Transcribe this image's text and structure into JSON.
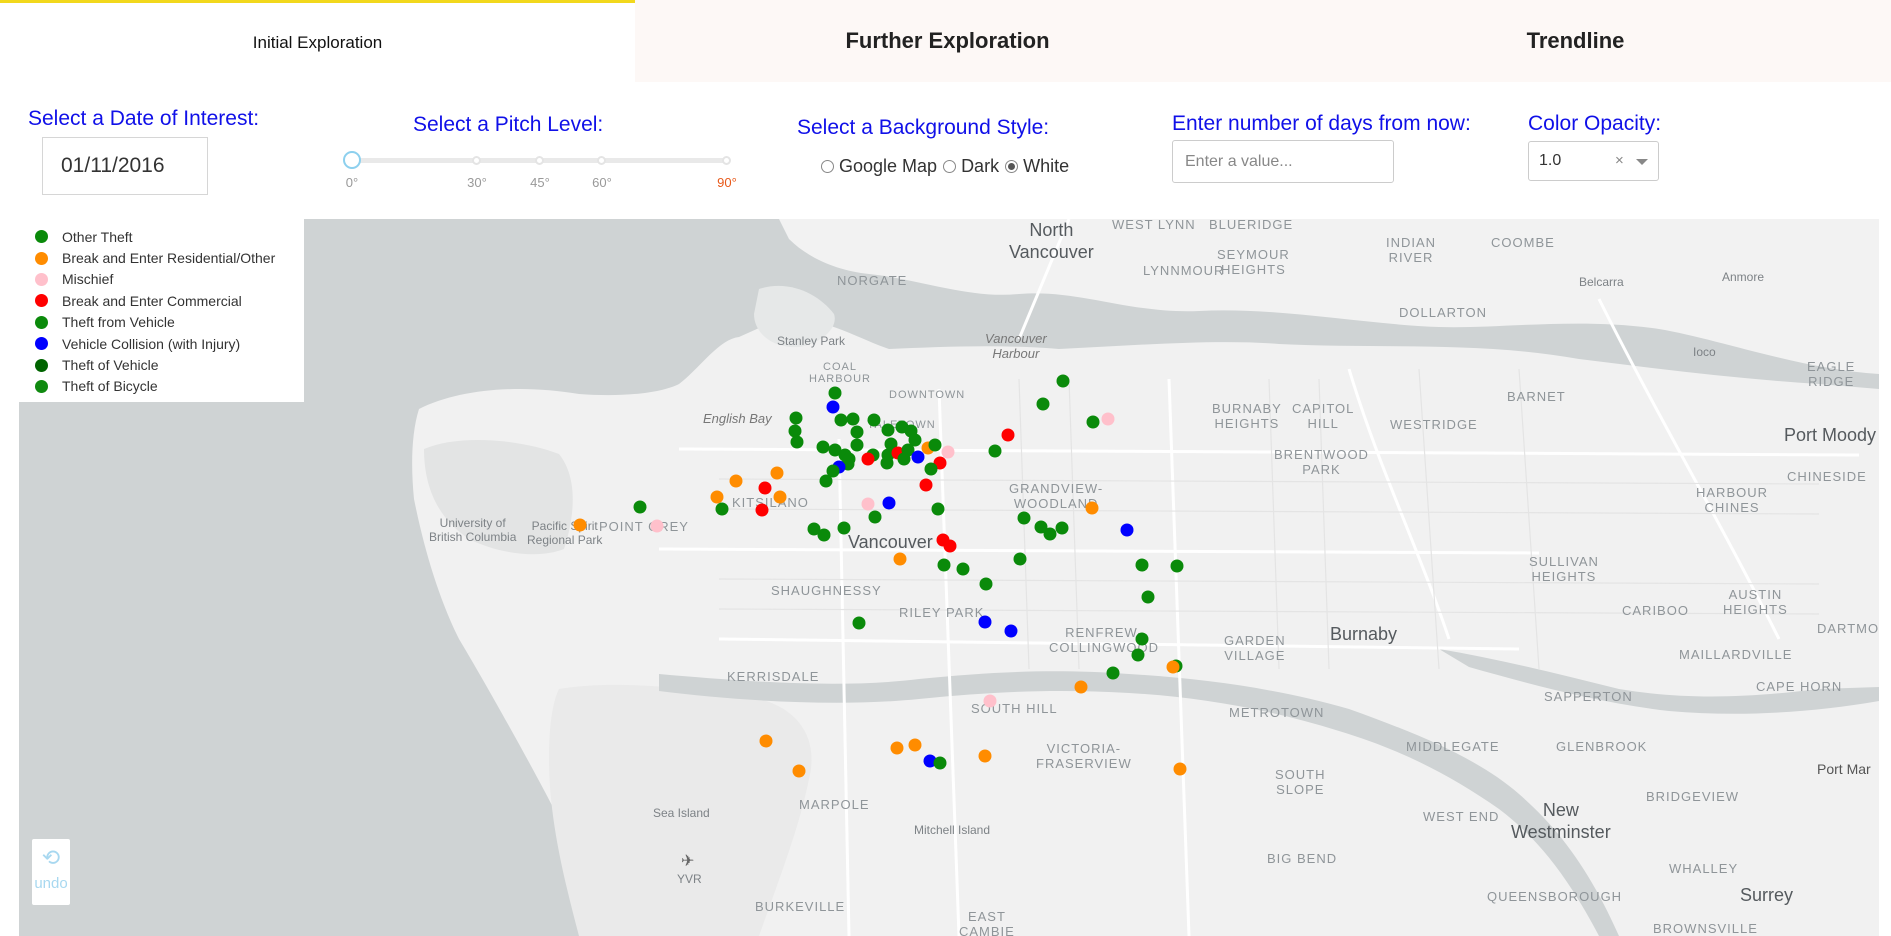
{
  "tabs": [
    {
      "label": "Initial Exploration",
      "selected": true
    },
    {
      "label": "Further Exploration",
      "selected": false
    },
    {
      "label": "Trendline",
      "selected": false
    }
  ],
  "controls": {
    "date_label": "Select a Date of Interest:",
    "date_value": "01/11/2016",
    "pitch_label": "Select a Pitch Level:",
    "pitch_marks": [
      "0°",
      "30°",
      "45°",
      "60°",
      "90°"
    ],
    "pitch_value": "0°",
    "background_label": "Select a Background Style:",
    "background_options": [
      "Google Map",
      "Dark",
      "White"
    ],
    "background_selected": "White",
    "days_label": "Enter number of days from now:",
    "days_placeholder": "Enter a value...",
    "opacity_label": "Color Opacity:",
    "opacity_value": "1.0",
    "opacity_clear": "×"
  },
  "legend": [
    {
      "label": "Other Theft",
      "color": "#0a8a0a"
    },
    {
      "label": "Break and Enter Residential/Other",
      "color": "#ff8c00"
    },
    {
      "label": "Mischief",
      "color": "#ffc0cb"
    },
    {
      "label": "Break and Enter Commercial",
      "color": "#ff0000"
    },
    {
      "label": "Theft from Vehicle",
      "color": "#0b8a0b"
    },
    {
      "label": "Vehicle Collision (with Injury)",
      "color": "#0000ff"
    },
    {
      "label": "Theft of Vehicle",
      "color": "#006400"
    },
    {
      "label": "Theft of Bicycle",
      "color": "#108a10"
    }
  ],
  "map_labels": {
    "north_vancouver": "North\nVancouver",
    "vancouver": "Vancouver",
    "burnaby": "Burnaby",
    "port_moody": "Port Moody",
    "new_westminster": "New\nWestminster",
    "surrey": "Surrey",
    "port_man": "Port Mar",
    "english_bay": "English Bay",
    "vancouver_harbour": "Vancouver\nHarbour",
    "stanley_park": "Stanley Park",
    "sea_island": "Sea Island",
    "mitchell_island": "Mitchell Island",
    "yvr": "YVR",
    "ubc": "University of\nBritish Columbia",
    "pacific_spirit": "Pacific Spirit\nRegional Park",
    "belcarra": "Belcarra",
    "anmore": "Anmore",
    "ioco": "Ioco",
    "west_lynn": "WEST LYNN",
    "blueridge": "BLUERIDGE",
    "seymour_heights": "SEYMOUR\nHEIGHTS",
    "indian_river": "INDIAN\nRIVER",
    "coombe": "COOMBE",
    "norgate": "NORGATE",
    "lynnmour": "LYNNMOUR",
    "dollarton": "DOLLARTON",
    "barnet": "BARNET",
    "eagle_ridge": "EAGLE\nRIDGE",
    "burnaby_heights": "BURNABY\nHEIGHTS",
    "capitol_hill": "CAPITOL\nHILL",
    "westridge": "WESTRIDGE",
    "brentwood_park": "BRENTWOOD\nPARK",
    "chineside": "CHINESIDE",
    "harbour_chines": "HARBOUR\nCHINES",
    "grandview_woodland": "GRANDVIEW-\nWOODLAND",
    "kitsilano": "KITSILANO",
    "point_grey": "POINT GREY",
    "shaughnessy": "SHAUGHNESSY",
    "riley_park": "RILEY PARK",
    "kerrisdale": "KERRISDALE",
    "renfrew_collingwood": "RENFREW-\nCOLLINGWOOD",
    "garden_village": "GARDEN\nVILLAGE",
    "sullivan_heights": "SULLIVAN\nHEIGHTS",
    "austin_heights": "AUSTIN\nHEIGHTS",
    "cariboo": "CARIBOO",
    "dartmoor": "DARTMOO",
    "maillardville": "MAILLARDVILLE",
    "sapperton": "SAPPERTON",
    "cape_horn": "CAPE HORN",
    "south_hill": "SOUTH HILL",
    "metrotown": "METROTOWN",
    "victoria_fraserview": "VICTORIA-\nFRASERVIEW",
    "middlegate": "MIDDLEGATE",
    "glenbrook": "GLENBROOK",
    "south_slope": "SOUTH\nSLOPE",
    "marpole": "MARPOLE",
    "west_end_nw": "WEST END",
    "bridgeview": "BRIDGEVIEW",
    "big_bend": "BIG BEND",
    "whalley": "WHALLEY",
    "queensborough": "QUEENSBOROUGH",
    "burkeville": "BURKEVILLE",
    "east_cambie": "EAST\nCAMBIE",
    "brownsville": "BROWNSVILLE",
    "coal_harbour": "COAL\nHARBOUR",
    "downtown": "DOWNTOWN",
    "yaletown": "YALETOWN"
  },
  "undo": {
    "label": "undo"
  }
}
